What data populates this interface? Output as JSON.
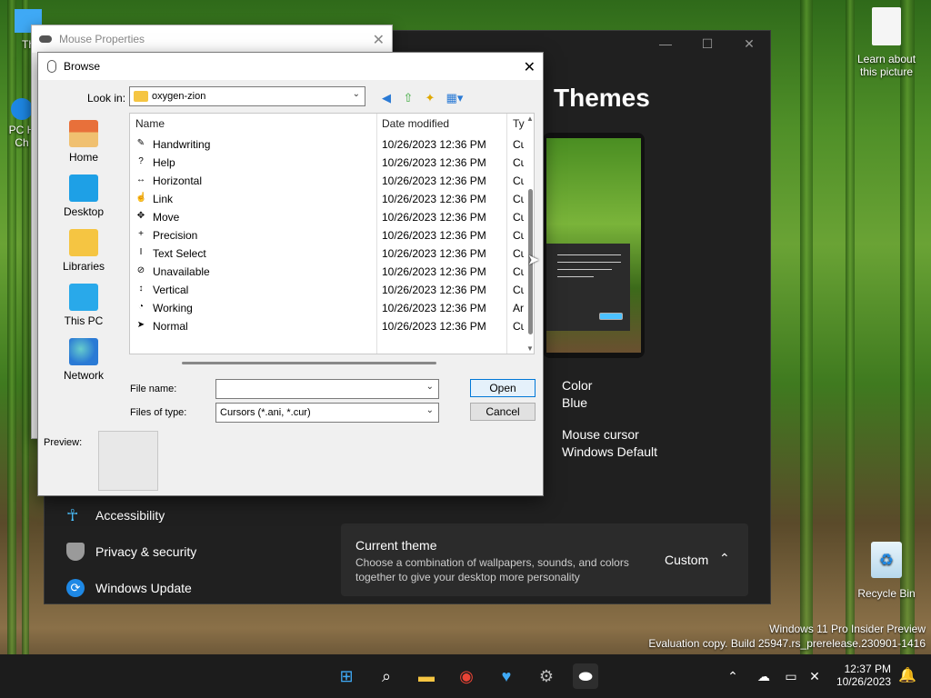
{
  "desktop": {
    "icons": [
      {
        "label": "Th",
        "name": "this-pc"
      },
      {
        "label": "PC H\nCh",
        "name": "pc-health-check"
      },
      {
        "label": "Learn about\nthis picture",
        "name": "learn-about-picture"
      },
      {
        "label": "Recycle Bin",
        "name": "recycle-bin"
      }
    ],
    "watermark_line1": "Windows 11 Pro Insider Preview",
    "watermark_line2": "Evaluation copy. Build 25947.rs_prerelease.230901-1416"
  },
  "settings": {
    "title": "Themes",
    "color_label": "Color",
    "color_value": "Blue",
    "cursor_label": "Mouse cursor",
    "cursor_value": "Windows Default",
    "sidebar": [
      {
        "label": "Accessibility",
        "icon": "accessibility-icon"
      },
      {
        "label": "Privacy & security",
        "icon": "shield-icon"
      },
      {
        "label": "Windows Update",
        "icon": "update-icon"
      }
    ],
    "current_theme": {
      "title": "Current theme",
      "description": "Choose a combination of wallpapers, sounds, and colors together to give your desktop more personality",
      "value": "Custom"
    }
  },
  "mouse_properties": {
    "title": "Mouse Properties"
  },
  "browse": {
    "title": "Browse",
    "look_in_label": "Look in:",
    "look_in_value": "oxygen-zion",
    "places": [
      "Home",
      "Desktop",
      "Libraries",
      "This PC",
      "Network"
    ],
    "columns": [
      "Name",
      "Date modified",
      "Ty"
    ],
    "files": [
      {
        "name": "Handwriting",
        "date": "10/26/2023 12:36 PM",
        "type": "Cu",
        "icon": "✎"
      },
      {
        "name": "Help",
        "date": "10/26/2023 12:36 PM",
        "type": "Cu",
        "icon": "?"
      },
      {
        "name": "Horizontal",
        "date": "10/26/2023 12:36 PM",
        "type": "Cu",
        "icon": "↔"
      },
      {
        "name": "Link",
        "date": "10/26/2023 12:36 PM",
        "type": "Cu",
        "icon": "☝"
      },
      {
        "name": "Move",
        "date": "10/26/2023 12:36 PM",
        "type": "Cu",
        "icon": "✥"
      },
      {
        "name": "Precision",
        "date": "10/26/2023 12:36 PM",
        "type": "Cu",
        "icon": "+"
      },
      {
        "name": "Text Select",
        "date": "10/26/2023 12:36 PM",
        "type": "Cu",
        "icon": "I"
      },
      {
        "name": "Unavailable",
        "date": "10/26/2023 12:36 PM",
        "type": "Cu",
        "icon": "⊘"
      },
      {
        "name": "Vertical",
        "date": "10/26/2023 12:36 PM",
        "type": "Cu",
        "icon": "↕"
      },
      {
        "name": "Working",
        "date": "10/26/2023 12:36 PM",
        "type": "Ar",
        "icon": "◔"
      },
      {
        "name": "Normal",
        "date": "10/26/2023 12:36 PM",
        "type": "Cu",
        "icon": "➤"
      }
    ],
    "file_name_label": "File name:",
    "file_name_value": "",
    "file_type_label": "Files of type:",
    "file_type_value": "Cursors (*.ani, *.cur)",
    "open_label": "Open",
    "cancel_label": "Cancel",
    "preview_label": "Preview:"
  },
  "taskbar": {
    "time": "12:37 PM",
    "date": "10/26/2023",
    "apps": [
      "start-icon",
      "search-icon",
      "file-explorer-icon",
      "chrome-icon",
      "health-icon",
      "settings-icon",
      "mouse-icon"
    ]
  },
  "colors": {
    "accent": "#0078d7",
    "settings_bg": "#202020",
    "taskbar_bg": "#1c1c1c"
  }
}
